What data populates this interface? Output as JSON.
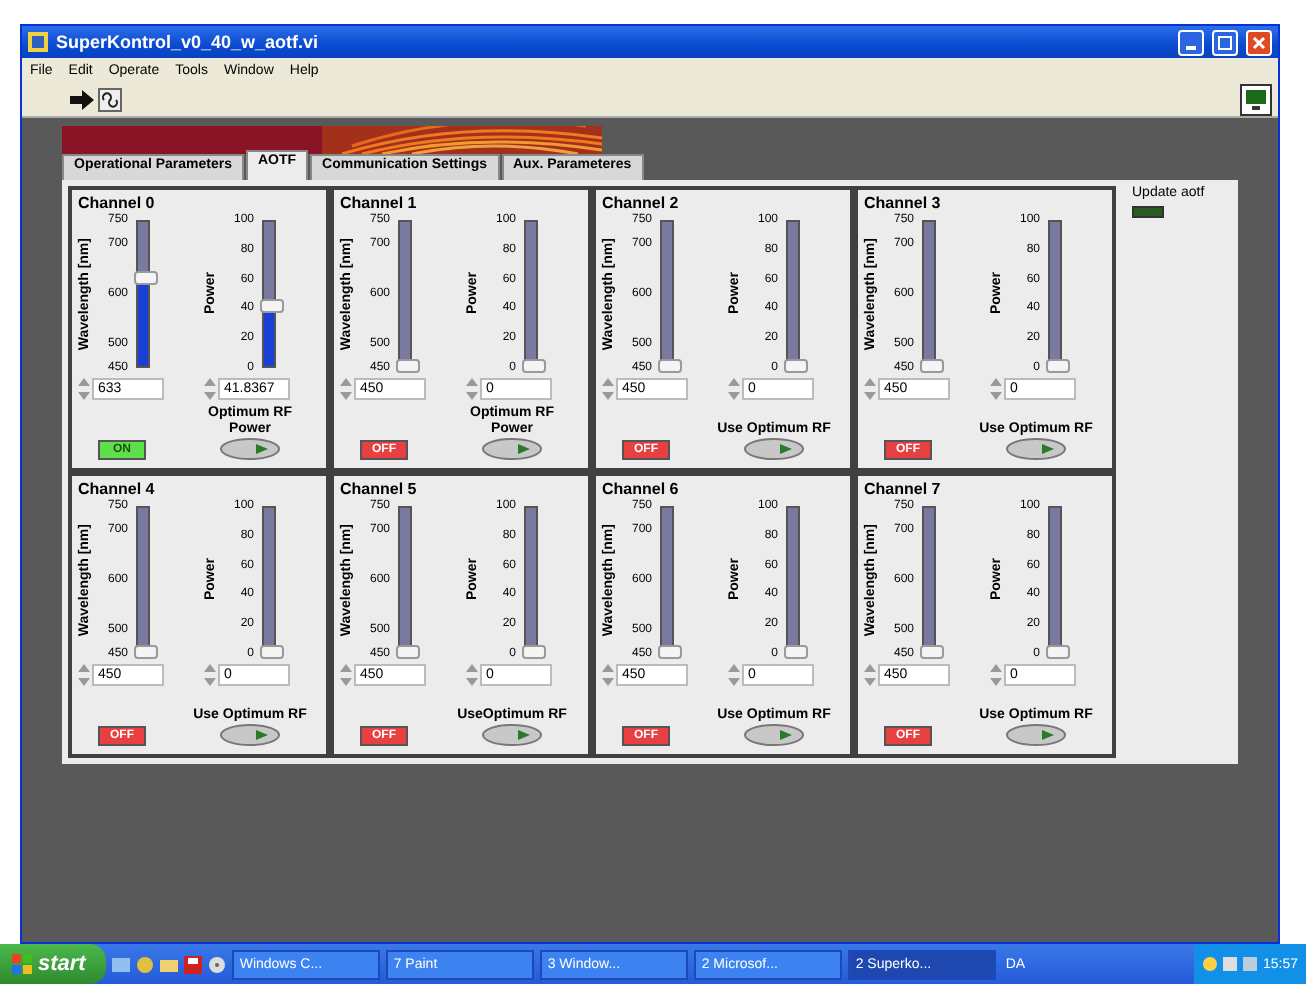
{
  "window": {
    "title": "SuperKontrol_v0_40_w_aotf.vi"
  },
  "menu": [
    "File",
    "Edit",
    "Operate",
    "Tools",
    "Window",
    "Help"
  ],
  "tabs": [
    {
      "label": "Operational Parameters",
      "selected": false
    },
    {
      "label": "AOTF",
      "selected": true
    },
    {
      "label": "Communication Settings",
      "selected": false
    },
    {
      "label": "Aux. Parameteres",
      "selected": false
    }
  ],
  "channels": [
    {
      "title": "Channel 0",
      "wavelength": {
        "label": "Wavelength [nm]",
        "value": "633",
        "level": 0.61,
        "scale": [
          "750",
          "700",
          "600",
          "500",
          "450"
        ]
      },
      "power": {
        "label": "Power",
        "value": "41.8367",
        "level": 0.42,
        "scale": [
          "100",
          "80",
          "60",
          "40",
          "20",
          "0"
        ]
      },
      "output": {
        "label": "ON",
        "on": true
      },
      "optimum": {
        "label": "Optimum RF Power",
        "on": false
      }
    },
    {
      "title": "Channel 1",
      "wavelength": {
        "label": "Wavelength [nm]",
        "value": "450",
        "level": 0,
        "scale": [
          "750",
          "700",
          "600",
          "500",
          "450"
        ]
      },
      "power": {
        "label": "Power",
        "value": "0",
        "level": 0,
        "scale": [
          "100",
          "80",
          "60",
          "40",
          "20",
          "0"
        ]
      },
      "output": {
        "label": "OFF",
        "on": false
      },
      "optimum": {
        "label": "Optimum RF Power",
        "on": false
      }
    },
    {
      "title": "Channel 2",
      "wavelength": {
        "label": "Wavelength [nm]",
        "value": "450",
        "level": 0,
        "scale": [
          "750",
          "700",
          "600",
          "500",
          "450"
        ]
      },
      "power": {
        "label": "Power",
        "value": "0",
        "level": 0,
        "scale": [
          "100",
          "80",
          "60",
          "40",
          "20",
          "0"
        ]
      },
      "output": {
        "label": "OFF",
        "on": false
      },
      "optimum": {
        "label": "Use Optimum RF",
        "on": false
      }
    },
    {
      "title": "Channel 3",
      "wavelength": {
        "label": "Wavelength [nm]",
        "value": "450",
        "level": 0,
        "scale": [
          "750",
          "700",
          "600",
          "500",
          "450"
        ]
      },
      "power": {
        "label": "Power",
        "value": "0",
        "level": 0,
        "scale": [
          "100",
          "80",
          "60",
          "40",
          "20",
          "0"
        ]
      },
      "output": {
        "label": "OFF",
        "on": false
      },
      "optimum": {
        "label": "Use Optimum RF",
        "on": false
      }
    },
    {
      "title": "Channel 4",
      "wavelength": {
        "label": "Wavelength [nm]",
        "value": "450",
        "level": 0,
        "scale": [
          "750",
          "700",
          "600",
          "500",
          "450"
        ]
      },
      "power": {
        "label": "Power",
        "value": "0",
        "level": 0,
        "scale": [
          "100",
          "80",
          "60",
          "40",
          "20",
          "0"
        ]
      },
      "output": {
        "label": "OFF",
        "on": false
      },
      "optimum": {
        "label": "Use Optimum RF",
        "on": false
      }
    },
    {
      "title": "Channel 5",
      "wavelength": {
        "label": "Wavelength [nm]",
        "value": "450",
        "level": 0,
        "scale": [
          "750",
          "700",
          "600",
          "500",
          "450"
        ]
      },
      "power": {
        "label": "Power",
        "value": "0",
        "level": 0,
        "scale": [
          "100",
          "80",
          "60",
          "40",
          "20",
          "0"
        ]
      },
      "output": {
        "label": "OFF",
        "on": false
      },
      "optimum": {
        "label": "UseOptimum RF",
        "on": false
      }
    },
    {
      "title": "Channel 6",
      "wavelength": {
        "label": "Wavelength [nm]",
        "value": "450",
        "level": 0,
        "scale": [
          "750",
          "700",
          "600",
          "500",
          "450"
        ]
      },
      "power": {
        "label": "Power",
        "value": "0",
        "level": 0,
        "scale": [
          "100",
          "80",
          "60",
          "40",
          "20",
          "0"
        ]
      },
      "output": {
        "label": "OFF",
        "on": false
      },
      "optimum": {
        "label": "Use Optimum RF",
        "on": false
      }
    },
    {
      "title": "Channel 7",
      "wavelength": {
        "label": "Wavelength [nm]",
        "value": "450",
        "level": 0,
        "scale": [
          "750",
          "700",
          "600",
          "500",
          "450"
        ]
      },
      "power": {
        "label": "Power",
        "value": "0",
        "level": 0,
        "scale": [
          "100",
          "80",
          "60",
          "40",
          "20",
          "0"
        ]
      },
      "output": {
        "label": "OFF",
        "on": false
      },
      "optimum": {
        "label": "Use Optimum RF",
        "on": false
      }
    }
  ],
  "update_aotf": {
    "label": "Update aotf",
    "on": false
  },
  "taskbar": {
    "start": "start",
    "items": [
      {
        "label": "Windows C...",
        "selected": false
      },
      {
        "label": "7 Paint",
        "selected": false
      },
      {
        "label": "3 Window...",
        "selected": false
      },
      {
        "label": "2 Microsof...",
        "selected": false
      },
      {
        "label": "2 Superko...",
        "selected": true
      }
    ],
    "language": "DA",
    "clock": "15:57"
  }
}
